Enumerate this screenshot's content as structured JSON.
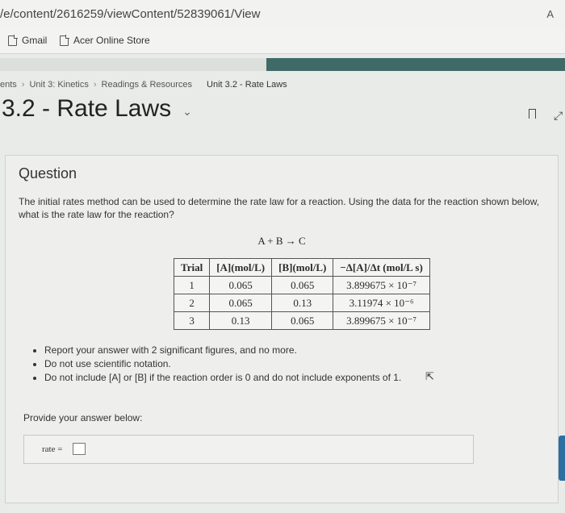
{
  "browser": {
    "url": "/e/content/2616259/viewContent/52839061/View",
    "reader_icon": "A",
    "bookmarks": [
      {
        "label": "Gmail",
        "icon": "page-icon"
      },
      {
        "label": "Acer Online Store",
        "icon": "page-icon"
      }
    ]
  },
  "breadcrumb": {
    "items": [
      "ents",
      "Unit 3: Kinetics",
      "Readings & Resources"
    ],
    "current": "Unit 3.2 - Rate Laws"
  },
  "page": {
    "title": "3.2 - Rate Laws"
  },
  "question": {
    "heading": "Question",
    "prompt": "The initial rates method can be used to determine the rate law for a reaction. Using the data for the reaction shown below, what is the rate law for the reaction?",
    "reaction": "A + B → C",
    "table": {
      "headers": [
        "Trial",
        "[A](mol/L)",
        "[B](mol/L)",
        "−Δ[A]/Δt (mol/L s)"
      ],
      "rows": [
        [
          "1",
          "0.065",
          "0.065",
          "3.899675 × 10⁻⁷"
        ],
        [
          "2",
          "0.065",
          "0.13",
          "3.11974 × 10⁻⁶"
        ],
        [
          "3",
          "0.13",
          "0.065",
          "3.899675 × 10⁻⁷"
        ]
      ]
    },
    "instructions": [
      "Report your answer with 2 significant figures, and no more.",
      "Do not use scientific notation.",
      "Do not include [A] or [B] if the reaction order is 0 and do not include exponents of 1."
    ],
    "answer_prompt": "Provide your answer below:",
    "answer_label": "rate =",
    "answer_value": ""
  }
}
